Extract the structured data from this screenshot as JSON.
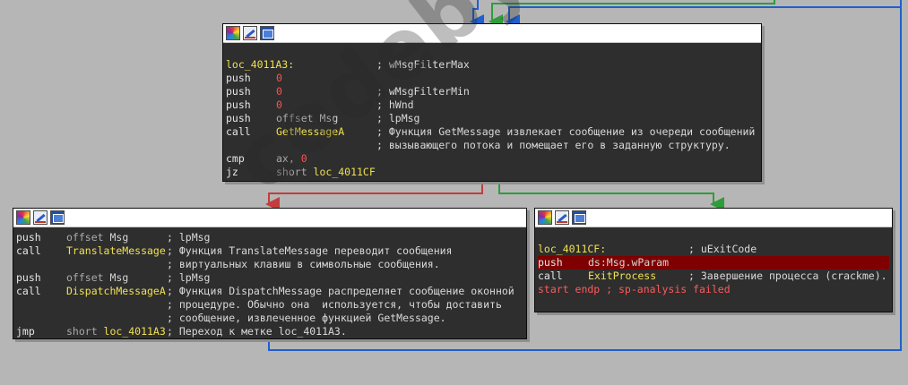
{
  "watermark": "codeby.net",
  "colors": {
    "canvas": "#b6b6b6",
    "node_bg": "#2e2e2e",
    "edge_true": "#2e9d3a",
    "edge_false": "#c43c3c",
    "edge_jump": "#1f5fcf",
    "selected_line": "#7e0000"
  },
  "nodes": {
    "top": {
      "header_icons": [
        "color-icon",
        "rename-icon",
        "graph-icon"
      ],
      "label": "loc_4011A3:",
      "label_comment": "; wMsgFilterMax",
      "lines": [
        {
          "m": "push",
          "o": "0",
          "c": ""
        },
        {
          "m": "push",
          "o": "0",
          "c": "; wMsgFilterMin"
        },
        {
          "m": "push",
          "o": "0",
          "c": "; hWnd"
        },
        {
          "m": "push",
          "o": "offset Msg",
          "c": "; lpMsg"
        },
        {
          "m": "call",
          "o": "GetMessageA",
          "c": "; Функция GetMessage извлекает сообщение из очереди сообщений"
        },
        {
          "m": "",
          "o": "",
          "c": "; вызывающего потока и помещает его в заданную структуру."
        },
        {
          "m": "cmp",
          "o": "ax, 0",
          "c": ""
        },
        {
          "m": "jz",
          "o": "short loc_4011CF",
          "c": ""
        }
      ]
    },
    "left": {
      "header_icons": [
        "color-icon",
        "rename-icon",
        "graph-icon"
      ],
      "lines": [
        {
          "m": "push",
          "o": "offset Msg",
          "c": "; lpMsg"
        },
        {
          "m": "call",
          "o": "TranslateMessage",
          "c": "; Функция TranslateMessage переводит сообщения"
        },
        {
          "m": "",
          "o": "",
          "c": "; виртуальных клавиш в символьные сообщения."
        },
        {
          "m": "push",
          "o": "offset Msg",
          "c": "; lpMsg"
        },
        {
          "m": "call",
          "o": "DispatchMessageA",
          "c": "; Функция DispatchMessage распределяет сообщение оконной"
        },
        {
          "m": "",
          "o": "",
          "c": "; процедуре. Обычно она  используется, чтобы доставить"
        },
        {
          "m": "",
          "o": "",
          "c": "; сообщение, извлеченное функцией GetMessage."
        },
        {
          "m": "jmp",
          "o": "short loc_4011A3",
          "c": "; Переход к метке loc_4011A3."
        }
      ]
    },
    "right": {
      "header_icons": [
        "color-icon",
        "rename-icon",
        "graph-icon"
      ],
      "label": "loc_4011CF:",
      "label_comment": "; uExitCode",
      "lines": [
        {
          "m": "push",
          "o": "ds:Msg.wParam",
          "c": ""
        },
        {
          "m": "call",
          "o": "ExitProcess",
          "c": "; Завершение процесса (crackme)."
        }
      ],
      "end_line": "start endp ; sp-analysis failed"
    }
  }
}
